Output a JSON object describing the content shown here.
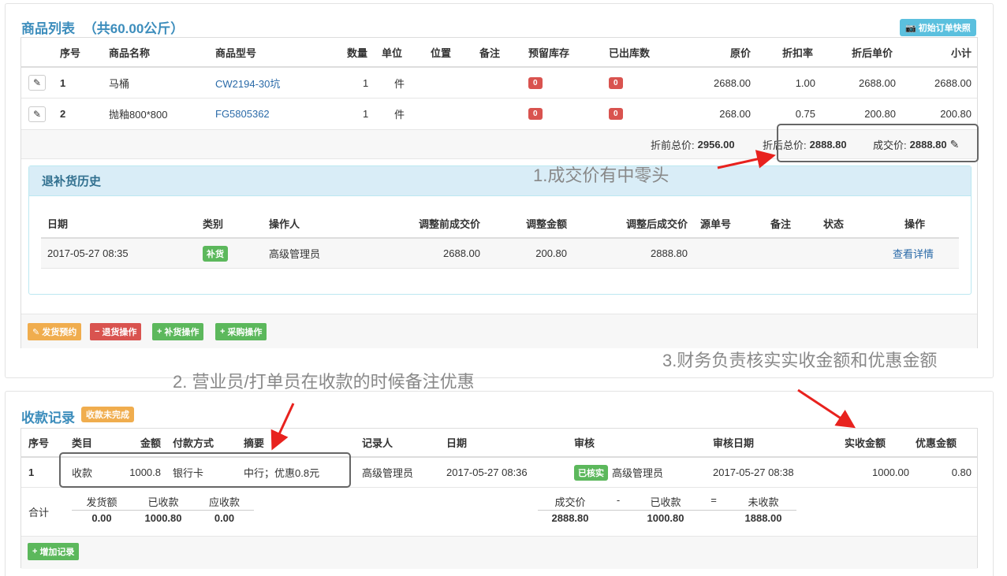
{
  "products": {
    "title": "商品列表",
    "title_weight": "（共60.00公斤）",
    "snapshot_button": "初始订单快照",
    "headers": [
      "序号",
      "商品名称",
      "商品型号",
      "数量",
      "单位",
      "位置",
      "备注",
      "预留库存",
      "已出库数",
      "原价",
      "折扣率",
      "折后单价",
      "小计"
    ],
    "rows": [
      {
        "index": "1",
        "name": "马桶",
        "model": "CW2194-30坑",
        "qty": "1",
        "unit": "件",
        "reserved": "0",
        "shipped": "0",
        "price": "2688.00",
        "discount": "1.00",
        "unit_after": "2688.00",
        "subtotal": "2688.00"
      },
      {
        "index": "2",
        "name": "抛釉800*800",
        "model": "FG5805362",
        "qty": "1",
        "unit": "件",
        "reserved": "0",
        "shipped": "0",
        "price": "268.00",
        "discount": "0.75",
        "unit_after": "200.80",
        "subtotal": "200.80"
      }
    ],
    "totals": {
      "before_label": "折前总价:",
      "before_value": "2956.00",
      "after_label": "折后总价:",
      "after_value": "2888.80",
      "deal_label": "成交价:",
      "deal_value": "2888.80"
    }
  },
  "history": {
    "title": "退补货历史",
    "headers": [
      "日期",
      "类别",
      "操作人",
      "调整前成交价",
      "调整金额",
      "调整后成交价",
      "源单号",
      "备注",
      "状态",
      "操作"
    ],
    "rows": [
      {
        "date": "2017-05-27 08:35",
        "type": "补货",
        "operator": "高级管理员",
        "before": "2688.00",
        "amount": "200.80",
        "after": "2888.80",
        "action": "查看详情"
      }
    ]
  },
  "actions": {
    "ship": "发货预约",
    "return": "退货操作",
    "replenish": "补货操作",
    "purchase": "采购操作"
  },
  "payments": {
    "title": "收款记录",
    "status_badge": "收款未完成",
    "headers": [
      "序号",
      "类目",
      "金额",
      "付款方式",
      "摘要",
      "记录人",
      "日期",
      "审核",
      "审核日期",
      "实收金额",
      "优惠金额"
    ],
    "rows": [
      {
        "index": "1",
        "category": "收款",
        "amount": "1000.8",
        "method": "银行卡",
        "memo": "中行；优惠0.8元",
        "recorder": "高级管理员",
        "date": "2017-05-27 08:36",
        "audit_badge": "已核实",
        "auditor": "高级管理员",
        "audit_date": "2017-05-27 08:38",
        "received": "1000.00",
        "discount": "0.80"
      }
    ],
    "summary": {
      "label": "合计",
      "shipped_label": "发货额",
      "shipped_value": "0.00",
      "received_label": "已收款",
      "received_value": "1000.80",
      "due_label": "应收款",
      "due_value": "0.00",
      "deal_label": "成交价",
      "deal_value": "2888.80",
      "minus": "-",
      "received2_label": "已收款",
      "received2_value": "1000.80",
      "equals": "=",
      "unpaid_label": "未收款",
      "unpaid_value": "1888.00"
    },
    "add_button": "增加记录"
  },
  "annotations": {
    "note1": "1.成交价有中零头",
    "note2": "2. 营业员/打单员在收款的时候备注优惠",
    "note3": "3.财务负责核实实收金额和优惠金额"
  },
  "colors": {
    "accent": "#3c8dbc",
    "danger": "#d9534f",
    "success": "#5cb85c",
    "warning": "#f0ad4e",
    "info": "#5bc0de",
    "arrow": "#e8221e"
  }
}
